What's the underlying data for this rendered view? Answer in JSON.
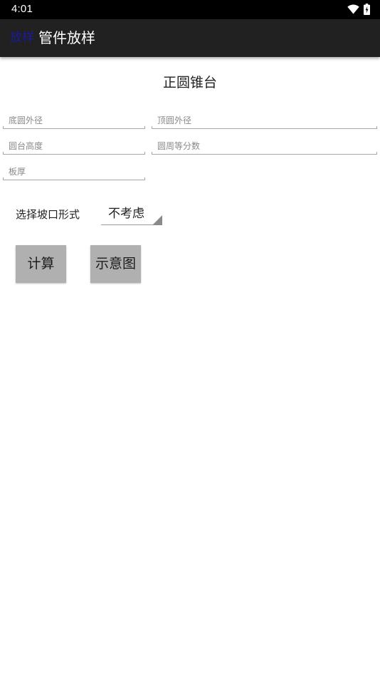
{
  "status_bar": {
    "time": "4:01",
    "icons": [
      "wifi-icon",
      "battery-charging-icon"
    ]
  },
  "app_bar": {
    "icon_text": "放样",
    "title": "管件放样",
    "background": "#212121",
    "icon_color": "#1a1a9c"
  },
  "page": {
    "title": "正圆锥台"
  },
  "fields": {
    "bottom_diameter": {
      "placeholder": "底圆外径",
      "value": ""
    },
    "top_diameter": {
      "placeholder": "顶圆外径",
      "value": ""
    },
    "height": {
      "placeholder": "圆台高度",
      "value": ""
    },
    "divisions": {
      "placeholder": "圆周等分数",
      "value": ""
    },
    "thickness": {
      "placeholder": "板厚",
      "value": ""
    }
  },
  "bevel": {
    "label": "选择坡口形式",
    "selected": "不考虑"
  },
  "buttons": {
    "calculate": "计算",
    "diagram": "示意图",
    "color": "#b0b0b0"
  }
}
